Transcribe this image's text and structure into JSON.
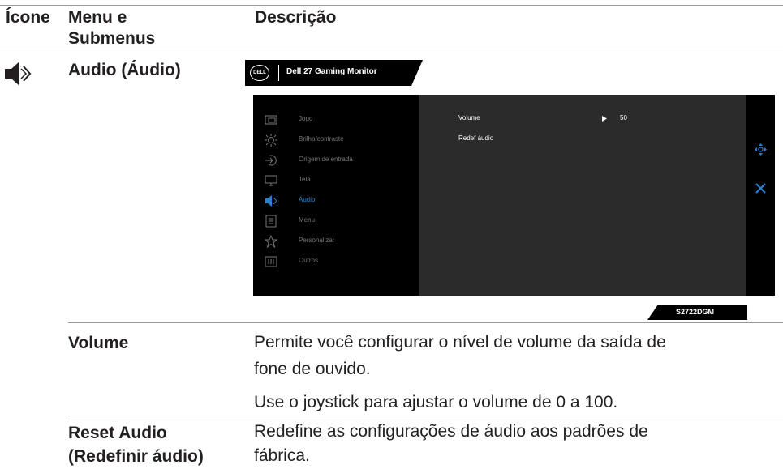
{
  "table": {
    "headers": {
      "icon": "Ícone",
      "menu_line1": "Menu e",
      "menu_line2": "Submenus",
      "description": "Descrição"
    },
    "section_title": "Audio (Áudio)",
    "rows": [
      {
        "label": "Volume",
        "desc_line1": "Permite você configurar o nível de volume da saída de",
        "desc_line2": "fone de ouvido.",
        "desc_line3": "Use o joystick para ajustar o volume de 0 a 100."
      },
      {
        "label_line1": "Reset Audio",
        "label_line2": "(Redefinir áudio)",
        "desc_line1": "Redefine as configurações de áudio aos padrões de",
        "desc_line2": "fábrica."
      }
    ]
  },
  "osd": {
    "logo": "DELL",
    "title": "Dell 27 Gaming Monitor",
    "menu_items": [
      {
        "label": "Jogo",
        "icon": "game-icon"
      },
      {
        "label": "Brilho/contraste",
        "icon": "brightness-icon"
      },
      {
        "label": "Origem de entrada",
        "icon": "input-source-icon"
      },
      {
        "label": "Tela",
        "icon": "display-icon"
      },
      {
        "label": "Áudio",
        "icon": "speaker-icon",
        "active": true
      },
      {
        "label": "Menu",
        "icon": "menu-icon"
      },
      {
        "label": "Personalizar",
        "icon": "star-icon"
      },
      {
        "label": "Outros",
        "icon": "others-icon"
      }
    ],
    "submenu": {
      "volume_label": "Volume",
      "volume_value": "50",
      "reset_label": "Redef áudio"
    },
    "model": "S2722DGM",
    "colors": {
      "accent": "#2d7fd0",
      "panel_left": "#000000",
      "panel_right": "#2b2b2b"
    }
  }
}
